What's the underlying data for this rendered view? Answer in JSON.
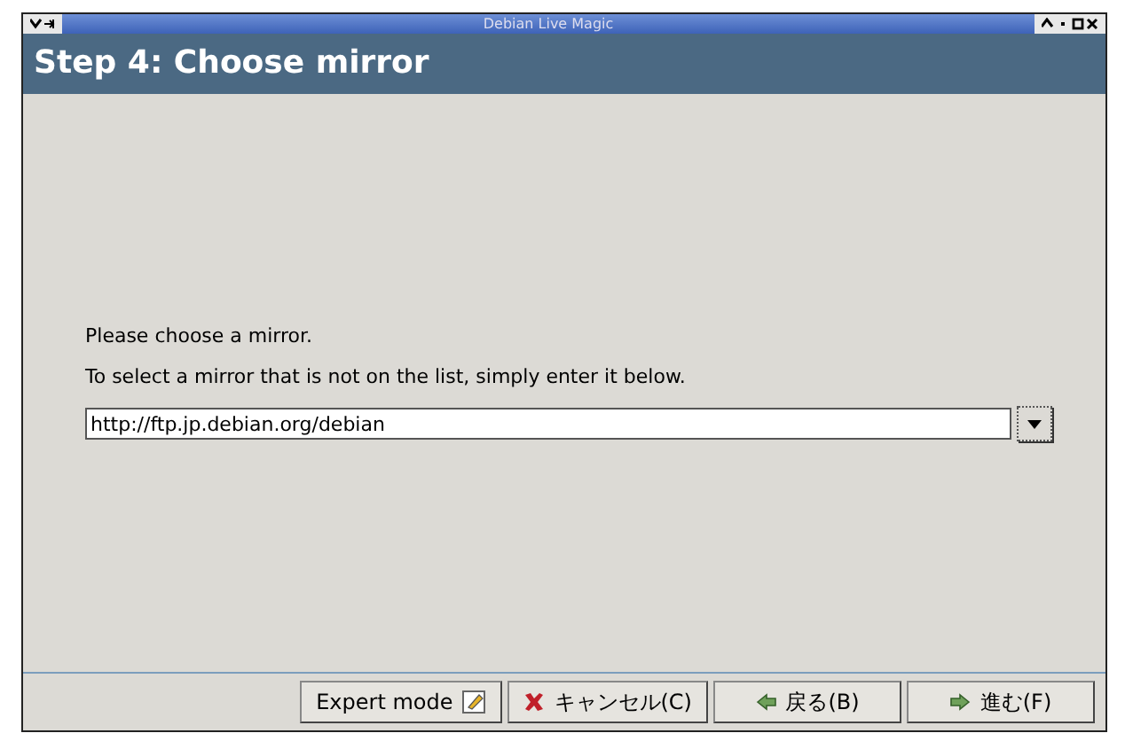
{
  "window": {
    "title": "Debian Live Magic"
  },
  "header": {
    "title": "Step 4: Choose mirror"
  },
  "body": {
    "prompt": "Please choose a mirror.",
    "hint": "To select a mirror that is not on the list, simply enter it below."
  },
  "mirror_field": {
    "value": "http://ftp.jp.debian.org/debian"
  },
  "buttons": [
    {
      "label": "Expert mode",
      "kind": "toggle"
    },
    {
      "label": "キャンセル(C)",
      "kind": "cancel"
    },
    {
      "label": "戻る(B)",
      "kind": "back"
    },
    {
      "label": "進む(F)",
      "kind": "forward"
    }
  ]
}
